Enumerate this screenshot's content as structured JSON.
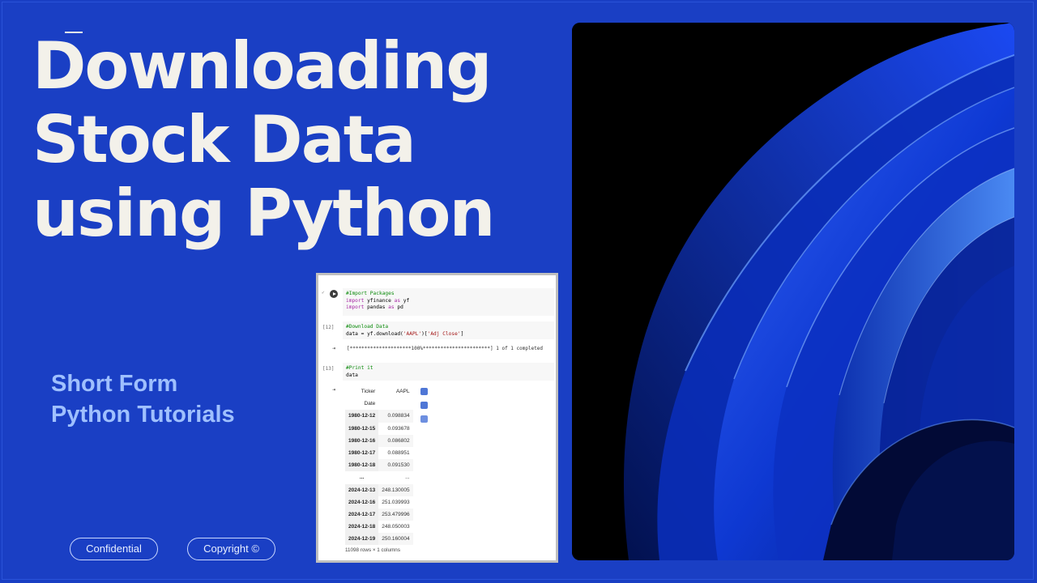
{
  "title": {
    "line1": "Downloading",
    "line2": "Stock Data",
    "line3": "using Python"
  },
  "subtitle": {
    "line1": "Short Form",
    "line2": "Python Tutorials"
  },
  "badges": {
    "confidential": "Confidential",
    "copyright": "Copyright ©"
  },
  "colors": {
    "background": "#1a3fc4",
    "title": "#f3f1ea",
    "subtitle": "#9fc0ff"
  },
  "notebook": {
    "cell1": {
      "gutter": "",
      "comment": "#Import Packages",
      "line2_kw": "import",
      "line2_rest": " yfinance ",
      "line2_as": "as",
      "line2_alias": " yf",
      "line3_kw": "import",
      "line3_rest": " pandas ",
      "line3_as": "as",
      "line3_alias": " pd"
    },
    "cell2": {
      "gutter": "[12]",
      "comment": "#Download Data",
      "code_pre": "data = yf.download(",
      "code_str1": "'AAPL'",
      "code_mid": ")[",
      "code_str2": "'Adj Close'",
      "code_post": "]",
      "progress": "[*********************100%***********************]  1 of 1 completed"
    },
    "cell3": {
      "gutter": "[13]",
      "comment": "#Print it",
      "code": "data",
      "table": {
        "header_ticker": "Ticker",
        "header_symbol": "AAPL",
        "index_name": "Date",
        "rows_top": [
          {
            "date": "1980-12-12",
            "value": "0.098834"
          },
          {
            "date": "1980-12-15",
            "value": "0.093678"
          },
          {
            "date": "1980-12-16",
            "value": "0.086802"
          },
          {
            "date": "1980-12-17",
            "value": "0.088951"
          },
          {
            "date": "1980-12-18",
            "value": "0.091530"
          }
        ],
        "ellipsis": "...",
        "rows_bottom": [
          {
            "date": "2024-12-13",
            "value": "248.130005"
          },
          {
            "date": "2024-12-16",
            "value": "251.039993"
          },
          {
            "date": "2024-12-17",
            "value": "253.479996"
          },
          {
            "date": "2024-12-18",
            "value": "248.050003"
          },
          {
            "date": "2024-12-19",
            "value": "250.160004"
          }
        ],
        "rows_info": "11098 rows × 1 columns"
      }
    }
  },
  "icons": {
    "run": "play-circle-icon",
    "output": "output-arrow-icon",
    "table_view": "table-icon",
    "chart": "chart-icon",
    "magic": "magic-wand-icon"
  }
}
